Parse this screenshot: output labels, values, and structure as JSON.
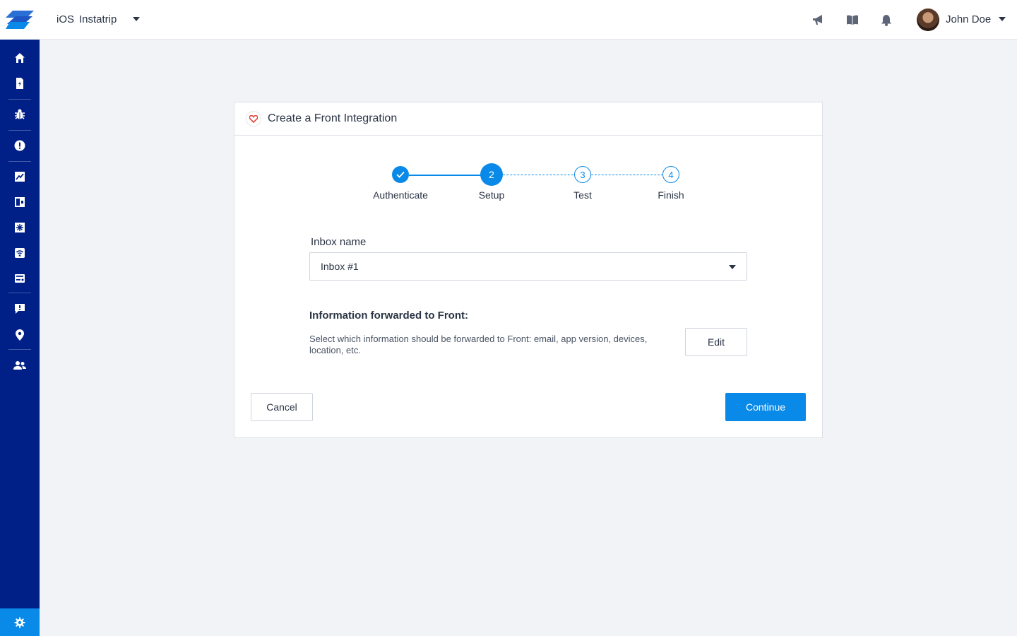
{
  "topbar": {
    "platform": "iOS",
    "app_name": "Instatrip",
    "user_name": "John Doe",
    "icons": [
      "megaphone-icon",
      "book-icon",
      "bell-icon"
    ]
  },
  "sidebar": {
    "items": [
      "home-icon",
      "crash-report-icon",
      "bug-icon",
      "alert-icon",
      "analytics-icon",
      "survey-icon",
      "snowflake-icon",
      "network-icon",
      "release-icon",
      "feedback-icon",
      "location-icon",
      "users-icon"
    ],
    "settings_icon": "gear-icon"
  },
  "dialog": {
    "title": "Create a Front Integration",
    "steps": [
      {
        "label": "Authenticate",
        "state": "done",
        "number": ""
      },
      {
        "label": "Setup",
        "state": "active",
        "number": "2"
      },
      {
        "label": "Test",
        "state": "todo",
        "number": "3"
      },
      {
        "label": "Finish",
        "state": "todo",
        "number": "4"
      }
    ],
    "inbox_label": "Inbox name",
    "inbox_value": "Inbox #1",
    "info_title": "Information forwarded to Front:",
    "info_description": "Select which information should be forwarded to Front: email, app version, devices, location, etc.",
    "edit_label": "Edit",
    "cancel_label": "Cancel",
    "continue_label": "Continue"
  },
  "colors": {
    "sidebar": "#002088",
    "accent": "#0a8ae8",
    "background": "#f2f3f7"
  }
}
